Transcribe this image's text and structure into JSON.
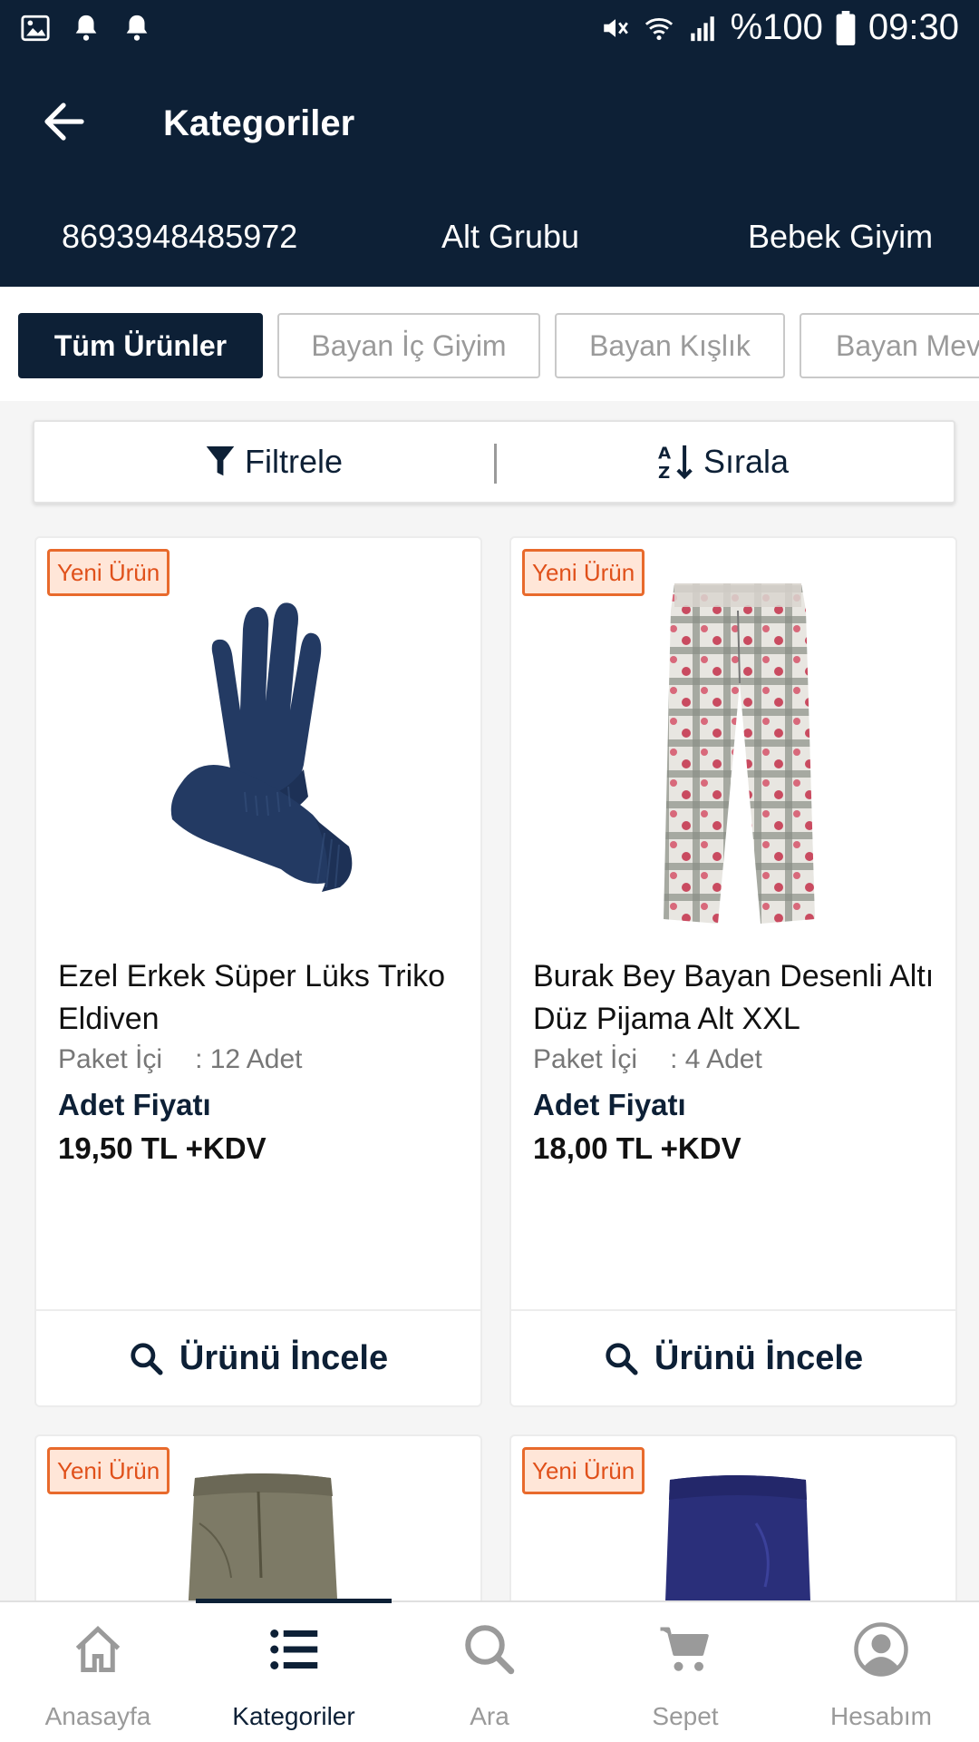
{
  "status_bar": {
    "icons_left": [
      "image-icon",
      "bell-icon",
      "bell-icon"
    ],
    "icons_right": [
      "mute-icon",
      "wifi-icon",
      "signal-icon"
    ],
    "battery": "%100",
    "time": "09:30"
  },
  "header": {
    "title": "Kategoriler",
    "breadcrumbs": [
      "8693948485972",
      "Alt Grubu",
      "Bebek Giyim"
    ]
  },
  "tabs": [
    {
      "label": "Tüm Ürünler",
      "active": true
    },
    {
      "label": "Bayan İç Giyim",
      "active": false
    },
    {
      "label": "Bayan Kışlık",
      "active": false
    },
    {
      "label": "Bayan Mev",
      "active": false
    }
  ],
  "toolbar": {
    "filter_label": "Filtrele",
    "sort_label": "Sırala"
  },
  "products": [
    {
      "badge": "Yeni Ürün",
      "name": "Ezel Erkek Süper Lüks Triko Eldiven",
      "pack_label": "Paket İçi",
      "pack_value": ": 12 Adet",
      "price_label": "Adet Fiyatı",
      "price": "19,50 TL +KDV",
      "button": "Ürünü İncele"
    },
    {
      "badge": "Yeni Ürün",
      "name": "Burak Bey Bayan Desenli Altı Düz Pijama Alt XXL",
      "pack_label": "Paket İçi",
      "pack_value": ": 4 Adet",
      "price_label": "Adet Fiyatı",
      "price": "18,00 TL +KDV",
      "button": "Ürünü İncele"
    },
    {
      "badge": "Yeni Ürün"
    },
    {
      "badge": "Yeni Ürün"
    }
  ],
  "bottom_nav": [
    {
      "label": "Anasayfa",
      "icon": "home-icon",
      "active": false
    },
    {
      "label": "Kategoriler",
      "icon": "list-icon",
      "active": true
    },
    {
      "label": "Ara",
      "icon": "search-icon",
      "active": false
    },
    {
      "label": "Sepet",
      "icon": "cart-icon",
      "active": false
    },
    {
      "label": "Hesabım",
      "icon": "account-icon",
      "active": false
    }
  ],
  "colors": {
    "primary": "#0d2036",
    "badge_border": "#e86a2c",
    "badge_bg": "#ffe6d8",
    "muted": "#9a9a9a"
  }
}
